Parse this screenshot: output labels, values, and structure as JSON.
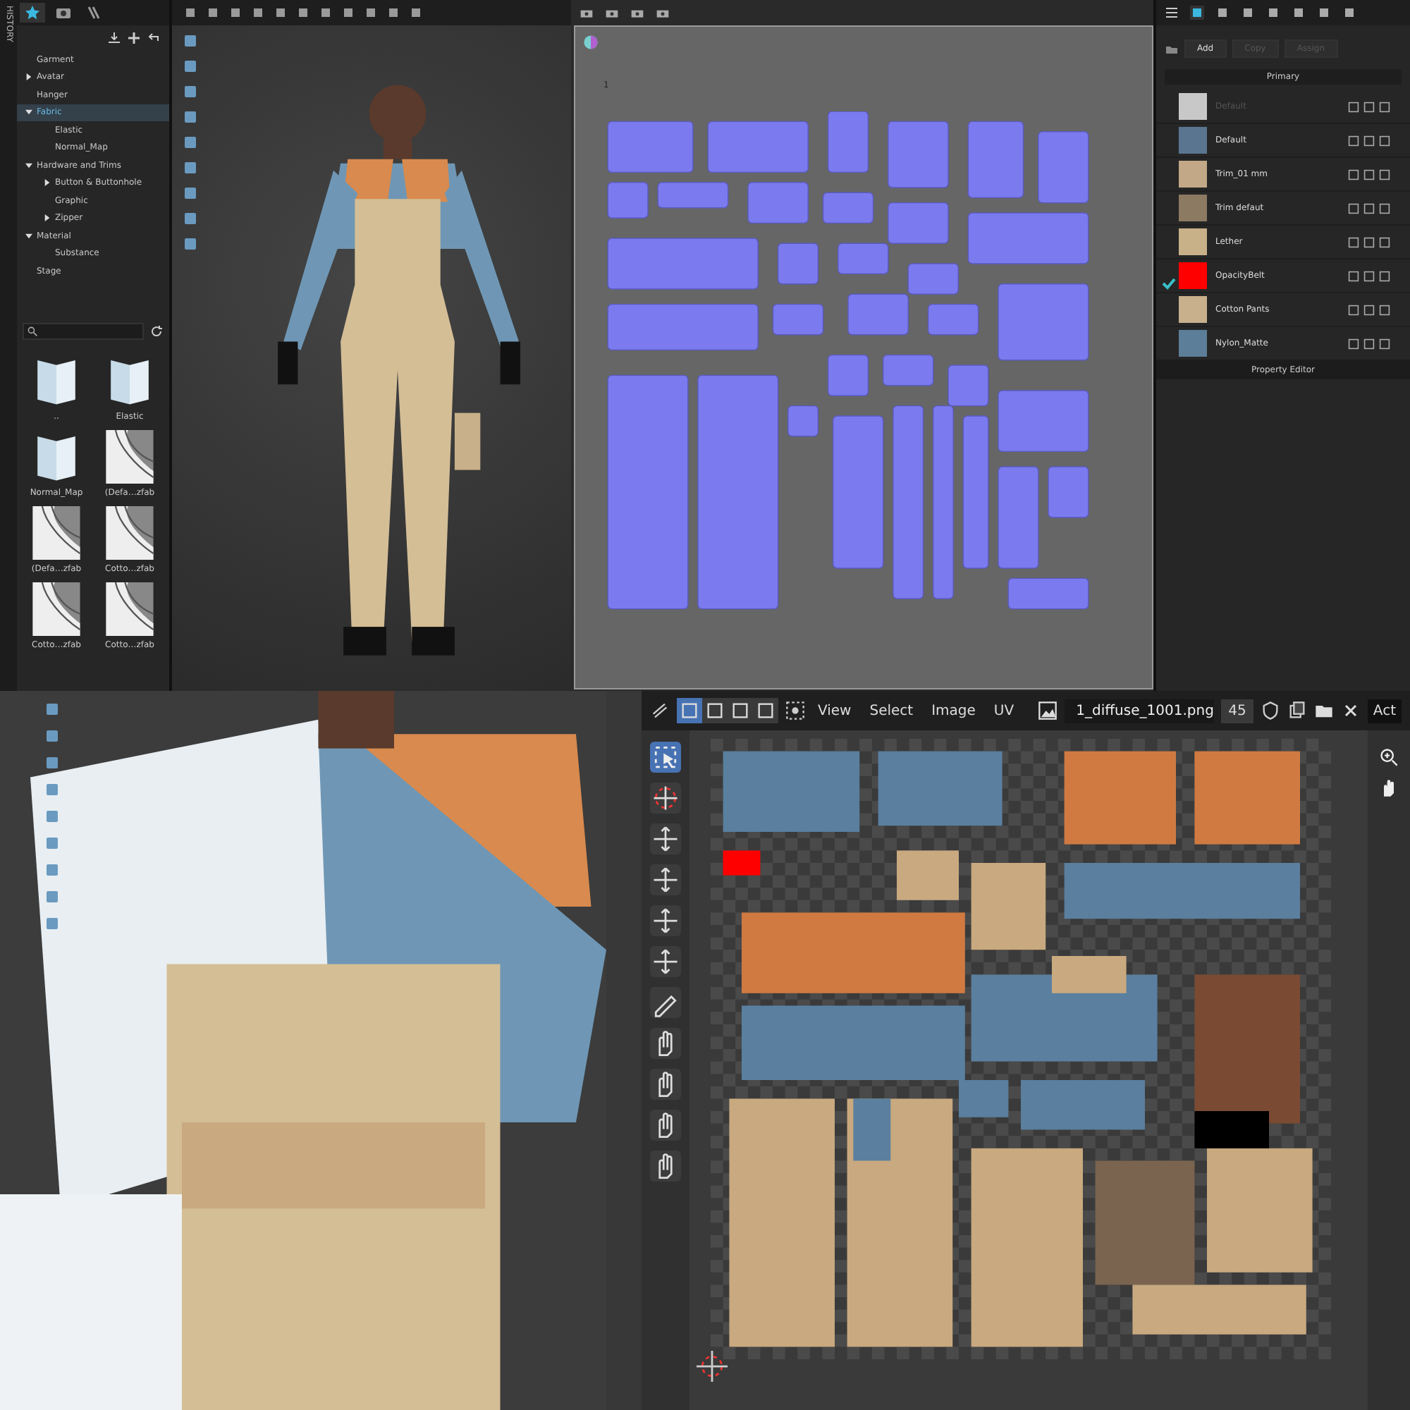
{
  "history_tab": "HISTORY",
  "library_tree": [
    {
      "label": "Garment",
      "kind": "leaf",
      "selected": false
    },
    {
      "label": "Avatar",
      "kind": "branch",
      "expanded": false,
      "selected": false
    },
    {
      "label": "Hanger",
      "kind": "leaf",
      "selected": false
    },
    {
      "label": "Fabric",
      "kind": "branch",
      "expanded": true,
      "selected": true,
      "children": [
        {
          "label": "Elastic",
          "kind": "leaf",
          "selected": false
        },
        {
          "label": "Normal_Map",
          "kind": "leaf",
          "selected": false
        }
      ]
    },
    {
      "label": "Hardware and Trims",
      "kind": "branch",
      "expanded": true,
      "selected": false,
      "children": [
        {
          "label": "Button & Buttonhole",
          "kind": "branch",
          "expanded": false,
          "selected": false
        },
        {
          "label": "Graphic",
          "kind": "leaf",
          "selected": false
        },
        {
          "label": "Zipper",
          "kind": "branch",
          "expanded": false,
          "selected": false
        }
      ]
    },
    {
      "label": "Material",
      "kind": "branch",
      "expanded": true,
      "selected": false,
      "children": [
        {
          "label": "Substance",
          "kind": "leaf",
          "selected": false
        }
      ]
    },
    {
      "label": "Stage",
      "kind": "leaf",
      "selected": false
    }
  ],
  "file_browser": [
    {
      "label": "..",
      "kind": "folder"
    },
    {
      "label": "Elastic",
      "kind": "folder"
    },
    {
      "label": "Normal_Map",
      "kind": "folder"
    },
    {
      "label": "(Defa…zfab",
      "kind": "fabric"
    },
    {
      "label": "(Defa…zfab",
      "kind": "fabric"
    },
    {
      "label": "Cotto…zfab",
      "kind": "fabric"
    },
    {
      "label": "Cotto…zfab",
      "kind": "fabric"
    },
    {
      "label": "Cotto…zfab",
      "kind": "fabric"
    }
  ],
  "uv_2d_window": {
    "tile_number": "1"
  },
  "material_panel": {
    "buttons": [
      {
        "label": "Add",
        "disabled": false
      },
      {
        "label": "Copy",
        "disabled": true
      },
      {
        "label": "Assign",
        "disabled": true
      }
    ],
    "group": "Primary",
    "materials": [
      {
        "name": "Default",
        "color": "#c8c8c8",
        "checked": false,
        "disabled": true
      },
      {
        "name": "Default",
        "color": "#5a7590",
        "checked": false,
        "disabled": false
      },
      {
        "name": "Trim_01 mm",
        "color": "#c2a886",
        "checked": false,
        "disabled": false
      },
      {
        "name": "Trim defaut",
        "color": "#8c7a62",
        "checked": false,
        "disabled": false
      },
      {
        "name": "Lether",
        "color": "#c8b088",
        "checked": false,
        "disabled": false
      },
      {
        "name": "OpacityBelt",
        "color": "#ff0000",
        "checked": true,
        "disabled": false
      },
      {
        "name": "Cotton Pants",
        "color": "#c8b08c",
        "checked": false,
        "disabled": false
      },
      {
        "name": "Nylon_Matte",
        "color": "#5c7e98",
        "checked": false,
        "disabled": false
      }
    ],
    "footer": "Property Editor"
  },
  "uv_editor": {
    "select_modes": [
      {
        "selected": true
      },
      {
        "selected": false
      },
      {
        "selected": false
      },
      {
        "selected": false
      }
    ],
    "menus": [
      "View",
      "Select",
      "Image",
      "UV"
    ],
    "image_name": "1_diffuse_1001.png",
    "users": "45",
    "tooltip": "Act"
  }
}
